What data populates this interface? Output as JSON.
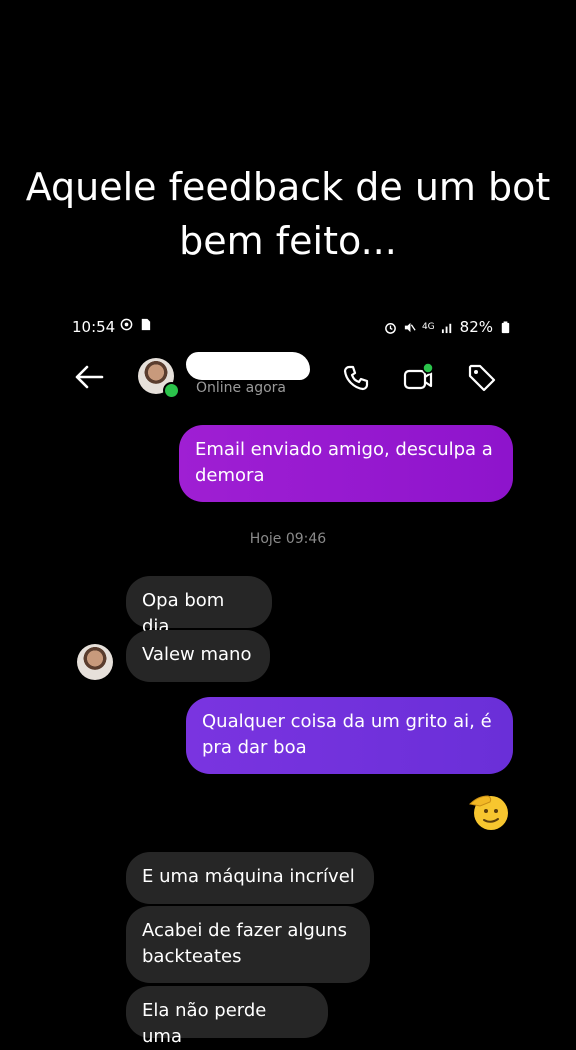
{
  "caption": {
    "line1": "Aquele feedback de um bot",
    "line2": "bem feito..."
  },
  "status_bar": {
    "time": "10:54",
    "network": "4G",
    "battery": "82%"
  },
  "header": {
    "presence": "Online agora",
    "icons": [
      "back-arrow-icon",
      "phone-icon",
      "video-call-icon",
      "tag-icon"
    ]
  },
  "messages": {
    "out1": "Email enviado amigo, desculpa a demora",
    "timestamp": "Hoje 09:46",
    "in1": "Opa bom dia",
    "in2": "Valew mano",
    "out2": "Qualquer coisa da um grito ai, é pra dar boa",
    "reaction": "🫡",
    "in3": "E uma máquina incrível",
    "in4": "Acabei de fazer alguns backteates",
    "in5": "Ela não perde uma"
  },
  "colors": {
    "background": "#000000",
    "outgoing_bubble_1": "#9a1bd1",
    "outgoing_bubble_2": "#7134de",
    "incoming_bubble": "#262626",
    "online_dot": "#2bc34b"
  }
}
